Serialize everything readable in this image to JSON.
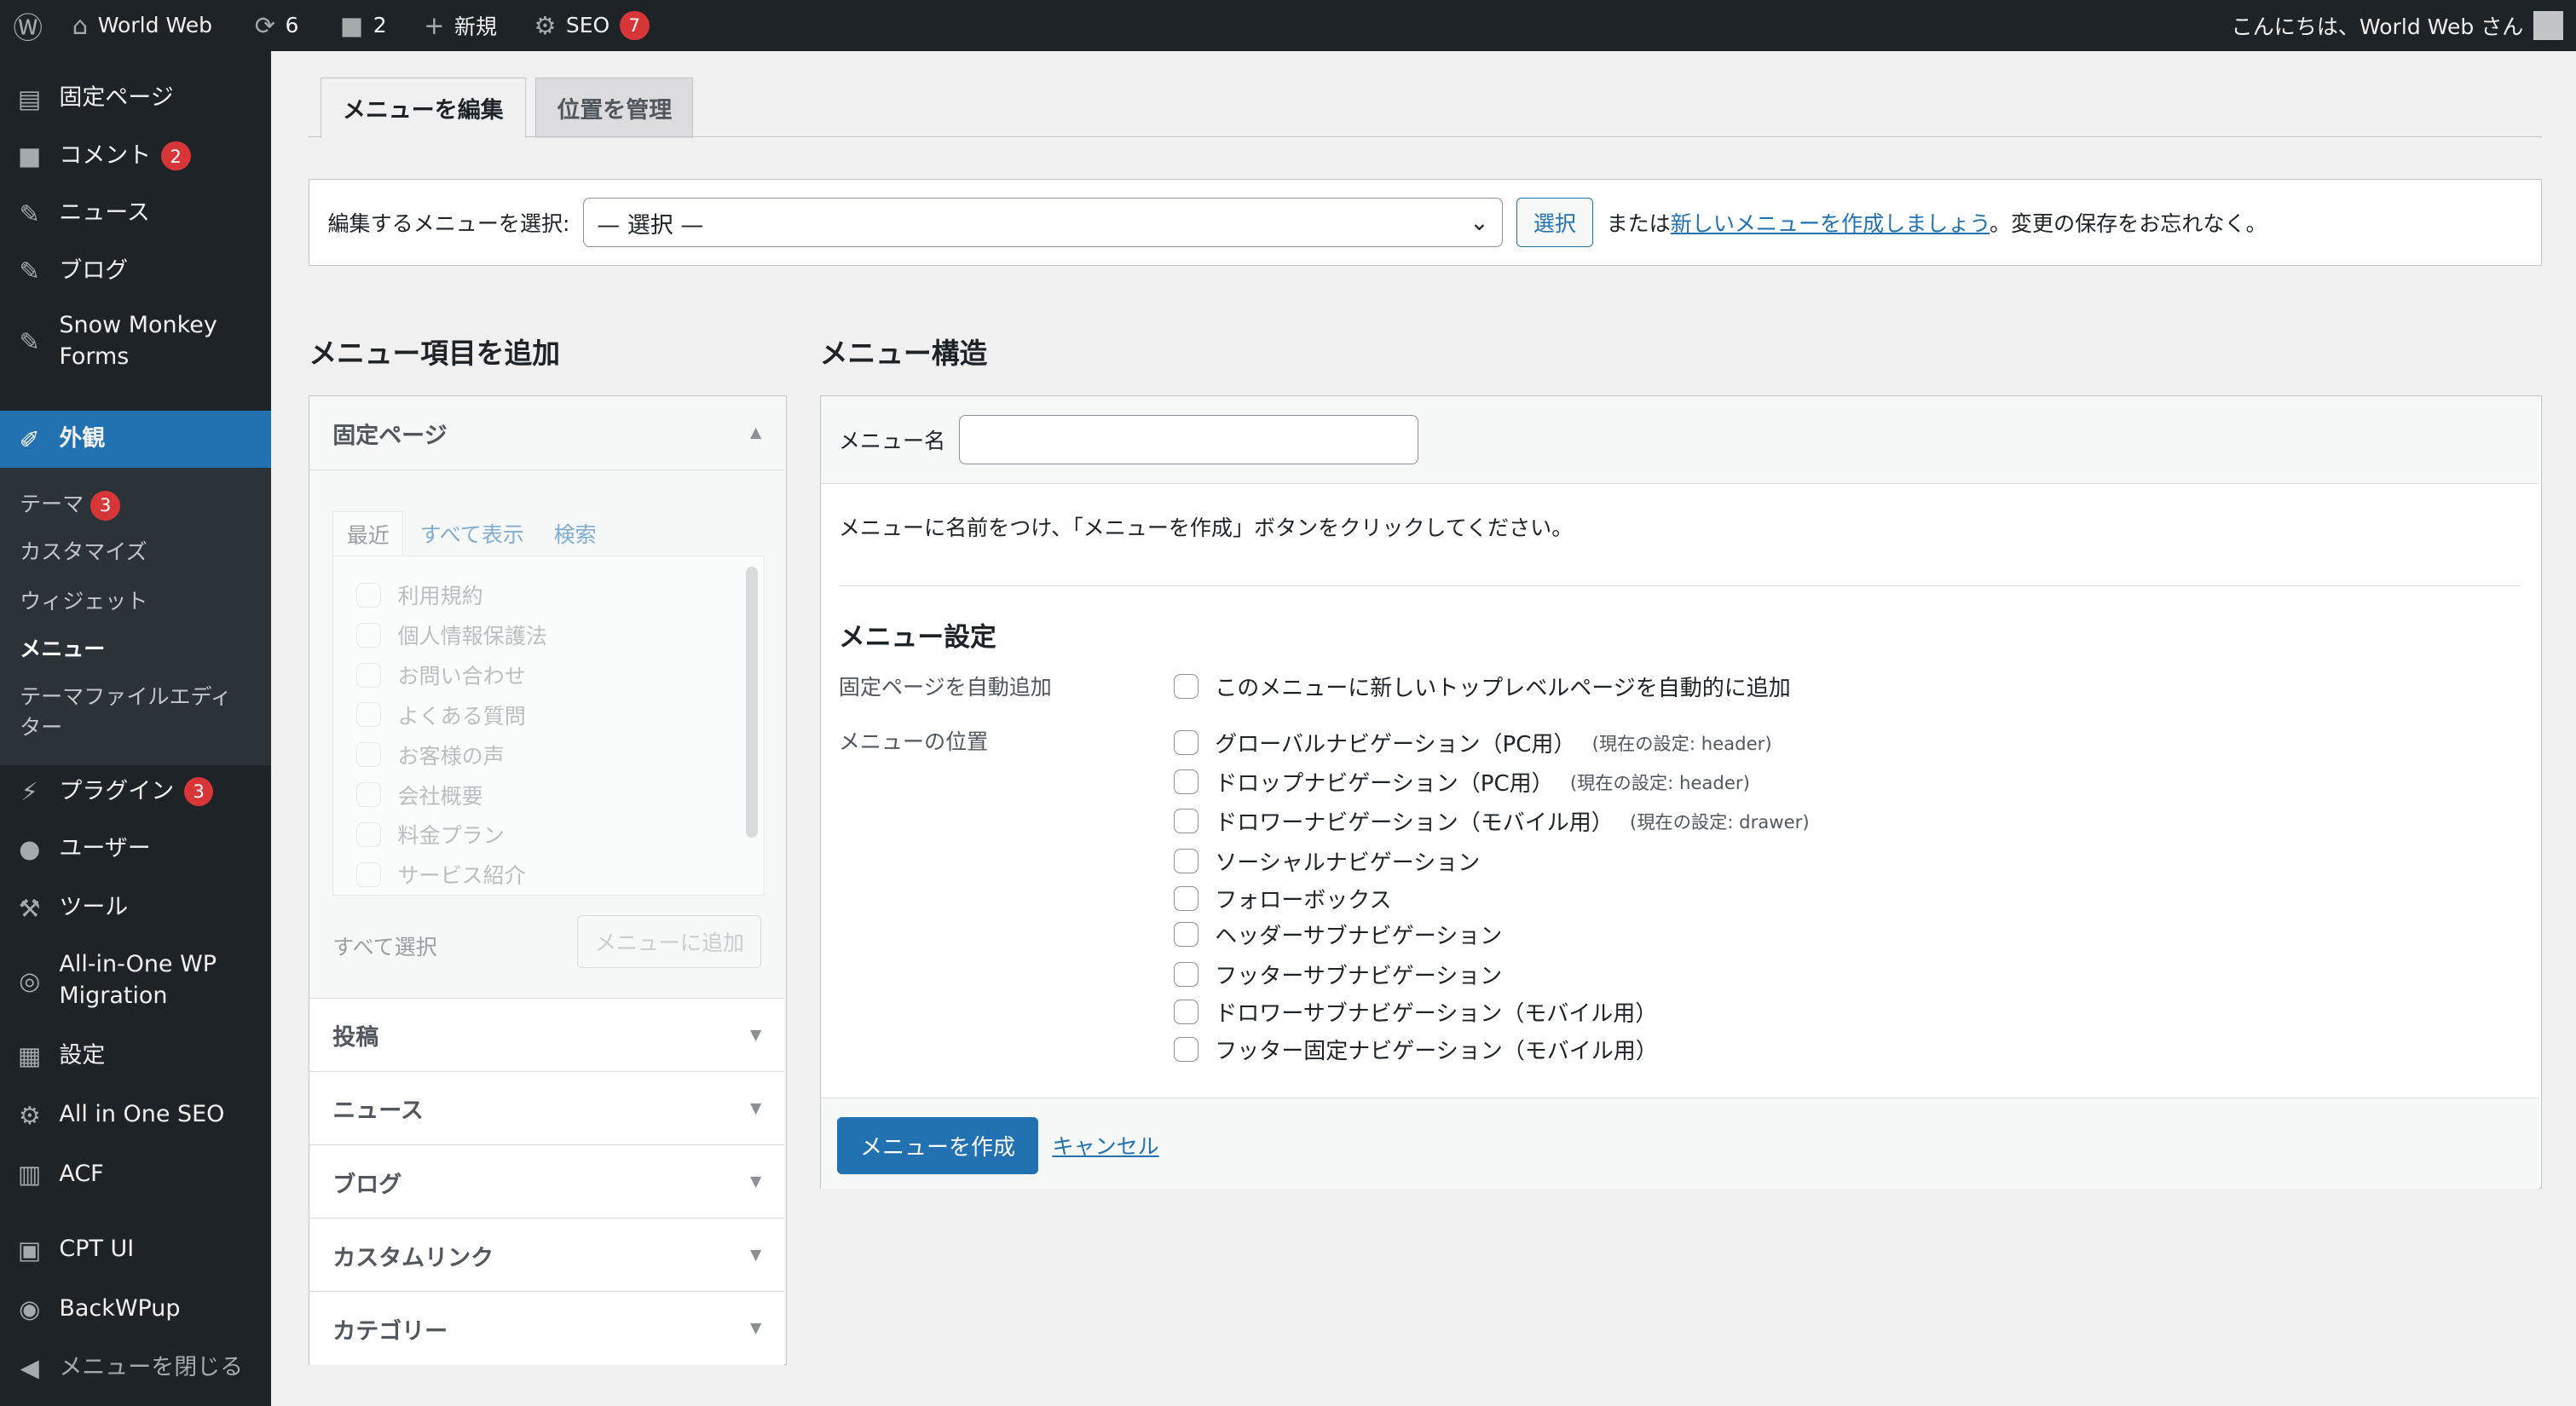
{
  "adminbar": {
    "site": "World Web",
    "updates": "6",
    "comments": "2",
    "new": "新規",
    "seo": "SEO",
    "seo_badge": "7",
    "greeting": "こんにちは、World Web さん"
  },
  "sidebar": {
    "items": [
      {
        "label": "固定ページ",
        "icon": "page-icon"
      },
      {
        "label": "コメント",
        "icon": "comment-icon",
        "badge": "2"
      },
      {
        "label": "ニュース",
        "icon": "pin-icon"
      },
      {
        "label": "ブログ",
        "icon": "pin-icon"
      },
      {
        "label": "Snow Monkey Forms",
        "icon": "pin-icon"
      },
      {
        "label": "外観",
        "icon": "brush-icon",
        "active": true
      },
      {
        "label": "プラグイン",
        "icon": "plugin-icon",
        "badge": "3"
      },
      {
        "label": "ユーザー",
        "icon": "user-icon"
      },
      {
        "label": "ツール",
        "icon": "wrench-icon"
      },
      {
        "label": "All-in-One WP Migration",
        "icon": "migration-icon"
      },
      {
        "label": "設定",
        "icon": "settings-icon"
      },
      {
        "label": "All in One SEO",
        "icon": "seo-icon"
      },
      {
        "label": "ACF",
        "icon": "acf-icon"
      },
      {
        "label": "CPT UI",
        "icon": "cpt-icon"
      },
      {
        "label": "BackWPup",
        "icon": "backup-icon"
      },
      {
        "label": "メニューを閉じる",
        "icon": "collapse-icon"
      }
    ],
    "submenu": [
      {
        "label": "テーマ",
        "badge": "3"
      },
      {
        "label": "カスタマイズ"
      },
      {
        "label": "ウィジェット"
      },
      {
        "label": "メニュー",
        "current": true
      },
      {
        "label": "テーマファイルエディター"
      }
    ]
  },
  "tabs": [
    "メニューを編集",
    "位置を管理"
  ],
  "select_bar": {
    "label": "編集するメニューを選択:",
    "value": "— 選択 —",
    "button": "選択",
    "prefix": "または",
    "link": "新しいメニューを作成しましょう",
    "suffix": "。変更の保存をお忘れなく。"
  },
  "left": {
    "title": "メニュー項目を追加",
    "pages_title": "固定ページ",
    "subtabs": [
      "最近",
      "すべて表示",
      "検索"
    ],
    "pages": [
      "利用規約",
      "個人情報保護法",
      "お問い合わせ",
      "よくある質問",
      "お客様の声",
      "会社概要",
      "料金プラン",
      "サービス紹介"
    ],
    "select_all": "すべて選択",
    "add_button": "メニューに追加",
    "sections": [
      "投稿",
      "ニュース",
      "ブログ",
      "カスタムリンク",
      "カテゴリー"
    ]
  },
  "right": {
    "title": "メニュー構造",
    "name_label": "メニュー名",
    "name_value": "",
    "instructions": "メニューに名前をつけ、「メニューを作成」ボタンをクリックしてください。",
    "settings_title": "メニュー設定",
    "auto_label": "固定ページを自動追加",
    "auto_option": "このメニューに新しいトップレベルページを自動的に追加",
    "location_label": "メニューの位置",
    "locations": [
      {
        "label": "グローバルナビゲーション（PC用）",
        "note": "(現在の設定: header)"
      },
      {
        "label": "ドロップナビゲーション（PC用）",
        "note": "(現在の設定: header)"
      },
      {
        "label": "ドロワーナビゲーション（モバイル用）",
        "note": "(現在の設定: drawer)"
      },
      {
        "label": "ソーシャルナビゲーション"
      },
      {
        "label": "フォローボックス"
      },
      {
        "label": "ヘッダーサブナビゲーション"
      },
      {
        "label": "フッターサブナビゲーション"
      },
      {
        "label": "ドロワーサブナビゲーション（モバイル用）"
      },
      {
        "label": "フッター固定ナビゲーション（モバイル用）"
      }
    ],
    "create_button": "メニューを作成",
    "cancel": "キャンセル"
  },
  "colors": {
    "accent": "#2271b1",
    "bar": "#1d2327",
    "badge": "#d63638"
  }
}
